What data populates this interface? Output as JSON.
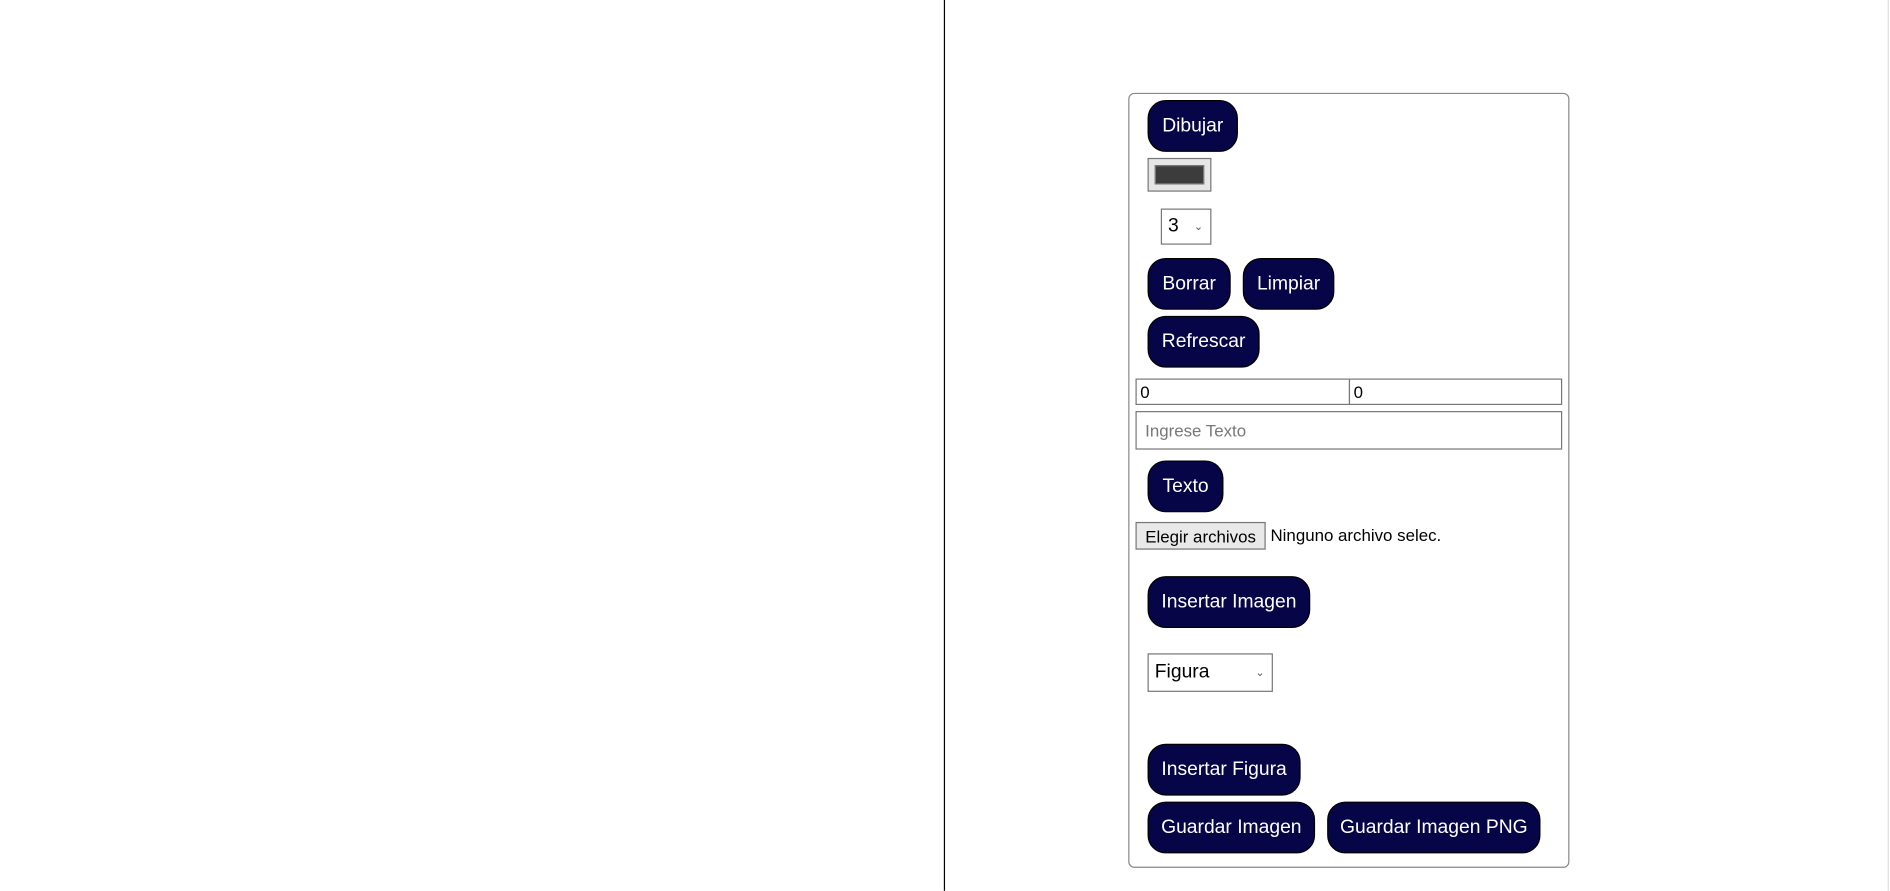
{
  "toolbar": {
    "draw_label": "Dibujar",
    "stroke_color": "#3c3c3c",
    "line_width": "3",
    "erase_label": "Borrar",
    "clear_label": "Limpiar",
    "refresh_label": "Refrescar",
    "x_value": "0",
    "y_value": "0",
    "text_placeholder": "Ingrese Texto",
    "text_label": "Texto",
    "file_button_label": "Elegir archivos",
    "file_status": "Ninguno archivo selec.",
    "insert_image_label": "Insertar Imagen",
    "shape_select": "Figura",
    "insert_shape_label": "Insertar Figura",
    "save_image_label": "Guardar Imagen",
    "save_png_label": "Guardar Imagen PNG"
  },
  "colors": {
    "button_bg": "#050547",
    "button_text": "#ffffff"
  }
}
